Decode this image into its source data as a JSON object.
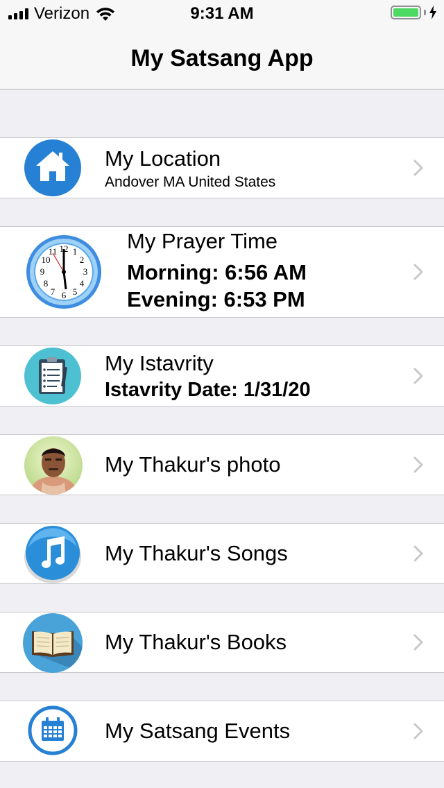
{
  "status_bar": {
    "carrier": "Verizon",
    "time": "9:31 AM",
    "battery_level": 1.0,
    "battery_color": "#4cd964"
  },
  "nav": {
    "title": "My Satsang App"
  },
  "rows": {
    "location": {
      "icon": "home-icon",
      "title": "My Location",
      "subtitle": "Andover MA United States"
    },
    "prayer": {
      "icon": "clock-icon",
      "title": "My Prayer Time",
      "morning": "Morning:  6:56 AM",
      "evening": "Evening:  6:53 PM"
    },
    "istavrity": {
      "icon": "clipboard-icon",
      "title": "My Istavrity",
      "date": "Istavrity Date:  1/31/20"
    },
    "photo": {
      "icon": "thakur-photo-avatar",
      "title": "My Thakur's photo"
    },
    "songs": {
      "icon": "music-note-icon",
      "title": "My Thakur's Songs"
    },
    "books": {
      "icon": "book-icon",
      "title": "My Thakur's Books"
    },
    "events": {
      "icon": "calendar-icon",
      "title": "My Satsang Events"
    }
  },
  "colors": {
    "accent_blue": "#2680d4",
    "teal": "#4dc1d1",
    "chevron": "#c7c7cc"
  }
}
